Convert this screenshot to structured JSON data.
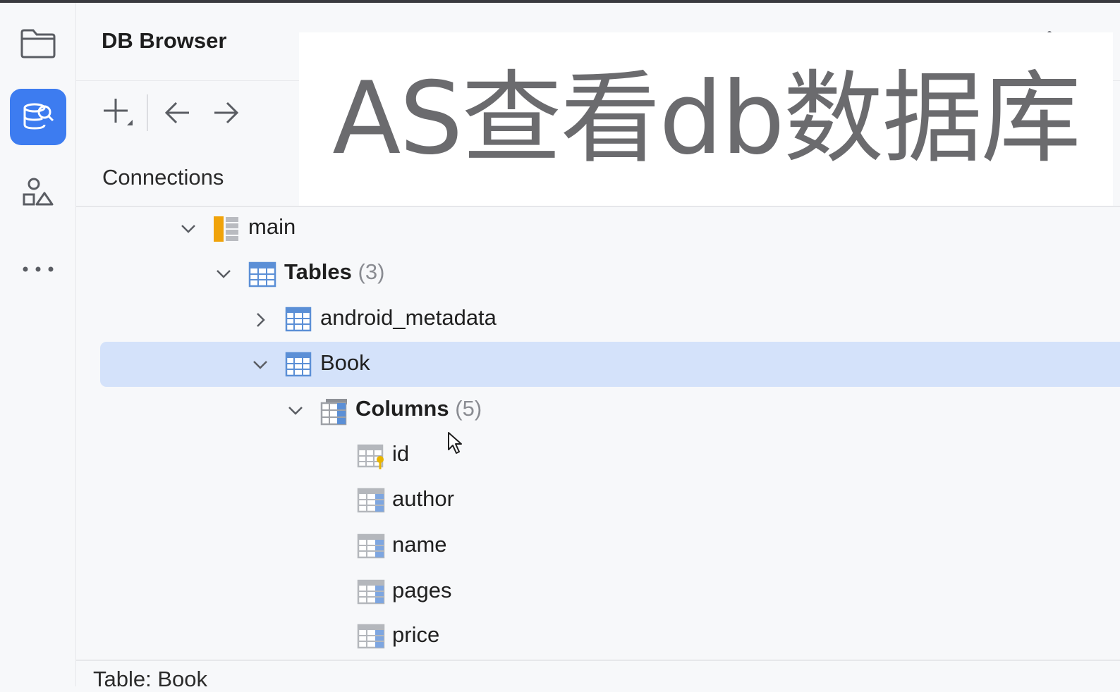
{
  "panel": {
    "title": "DB Browser",
    "connection_label": "Connections"
  },
  "overlay": {
    "caption": "AS查看db数据库"
  },
  "left_strip": {
    "items": [
      "folder-icon",
      "db-browser-icon",
      "shapes-icon",
      "more-icon"
    ],
    "active": "db-browser-icon"
  },
  "toolbar": {
    "items": [
      "add-icon",
      "back-icon",
      "forward-icon"
    ]
  },
  "tree": {
    "main": {
      "label": "main"
    },
    "tables": {
      "label": "Tables",
      "count": "(3)"
    },
    "android_metadata": {
      "label": "android_metadata"
    },
    "book": {
      "label": "Book"
    },
    "columns": {
      "label": "Columns",
      "count": "(5)"
    },
    "cols": [
      "id",
      "author",
      "name",
      "pages",
      "price"
    ]
  },
  "status": {
    "label": "Table: Book"
  },
  "colors": {
    "accent": "#3d7cf0",
    "selection": "#d4e2fa",
    "table_icon": "#5b8fd6",
    "schema_icon": "#f0a30a",
    "key_icon": "#e8b400"
  }
}
